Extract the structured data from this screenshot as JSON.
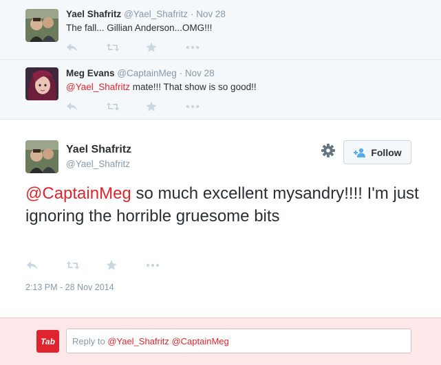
{
  "tweets": [
    {
      "name": "Yael Shafritz",
      "handle": "@Yael_Shafritz",
      "separator": "·",
      "date": "Nov 28",
      "text": "The fall... Gillian Anderson...OMG!!!"
    },
    {
      "name": "Meg Evans",
      "handle": "@CaptainMeg",
      "separator": "·",
      "date": "Nov 28",
      "mention": "@Yael_Shafritz",
      "text": " mate!!! That show is so good!!"
    }
  ],
  "main_tweet": {
    "name": "Yael Shafritz",
    "handle": "@Yael_Shafritz",
    "follow_label": "Follow",
    "mention": "@CaptainMeg",
    "text": " so much excellent mysandry!!!!  I'm just ignoring the horrible gruesome bits",
    "timestamp": "2:13 PM - 28 Nov 2014"
  },
  "reply": {
    "logo_text": "Tab",
    "prefix": "Reply to ",
    "mentions": "@Yael_Shafritz @CaptainMeg"
  },
  "icons": [
    "reply-icon",
    "retweet-icon",
    "favorite-icon",
    "more-icon",
    "gear-icon",
    "follow-user-icon"
  ],
  "colors": {
    "mention": "#e0242d",
    "muted": "#8899a6",
    "action_icon": "#ccd6dd",
    "reply_bg": "#fde7e8",
    "follow_icon": "#55acee"
  }
}
